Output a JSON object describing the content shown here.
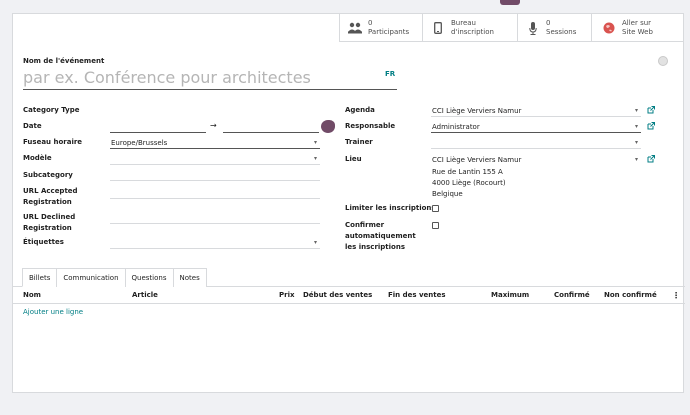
{
  "smart_buttons": [
    {
      "value": "0",
      "label": "Participants",
      "icon": "users-icon"
    },
    {
      "value": "Bureau",
      "label": "d'inscription",
      "icon": "tablet-icon"
    },
    {
      "value": "0",
      "label": "Sessions",
      "icon": "microphone-icon"
    },
    {
      "value": "Aller sur",
      "label": "Site Web",
      "icon": "globe-icon"
    }
  ],
  "title": {
    "label": "Nom de l'événement",
    "placeholder": "par ex. Conférence pour architectes",
    "lang": "FR"
  },
  "left_fields": {
    "category_type": "Category Type",
    "date": "Date",
    "date_arrow": "→",
    "timezone_label": "Fuseau horaire",
    "timezone_value": "Europe/Brussels",
    "template": "Modèle",
    "subcategory": "Subcategory",
    "url_accepted": "URL Accepted Registration",
    "url_declined": "URL Declined Registration",
    "tags": "Étiquettes"
  },
  "right_fields": {
    "agenda_label": "Agenda",
    "agenda_value": "CCI Liège Verviers Namur",
    "responsible_label": "Responsable",
    "responsible_value": "Administrator",
    "trainer_label": "Trainer",
    "venue_label": "Lieu",
    "venue_value": "CCI Liège Verviers Namur",
    "venue_addr1": "Rue de Lantin 155 A",
    "venue_addr2": "4000 Liège (Rocourt)",
    "venue_addr3": "Belgique",
    "limit_label": "Limiter les inscriptions",
    "autoconfirm_label": "Confirmer automatiquement les inscriptions"
  },
  "tabs": [
    "Billets",
    "Communication",
    "Questions",
    "Notes"
  ],
  "table": {
    "headers": [
      "Nom",
      "Article",
      "Prix",
      "Début des ventes",
      "Fin des ventes",
      "Maximum",
      "Confirmé",
      "Non confirmé"
    ],
    "add_line": "Ajouter une ligne"
  },
  "colors": {
    "accent": "#017e84",
    "brand": "#714b67"
  }
}
